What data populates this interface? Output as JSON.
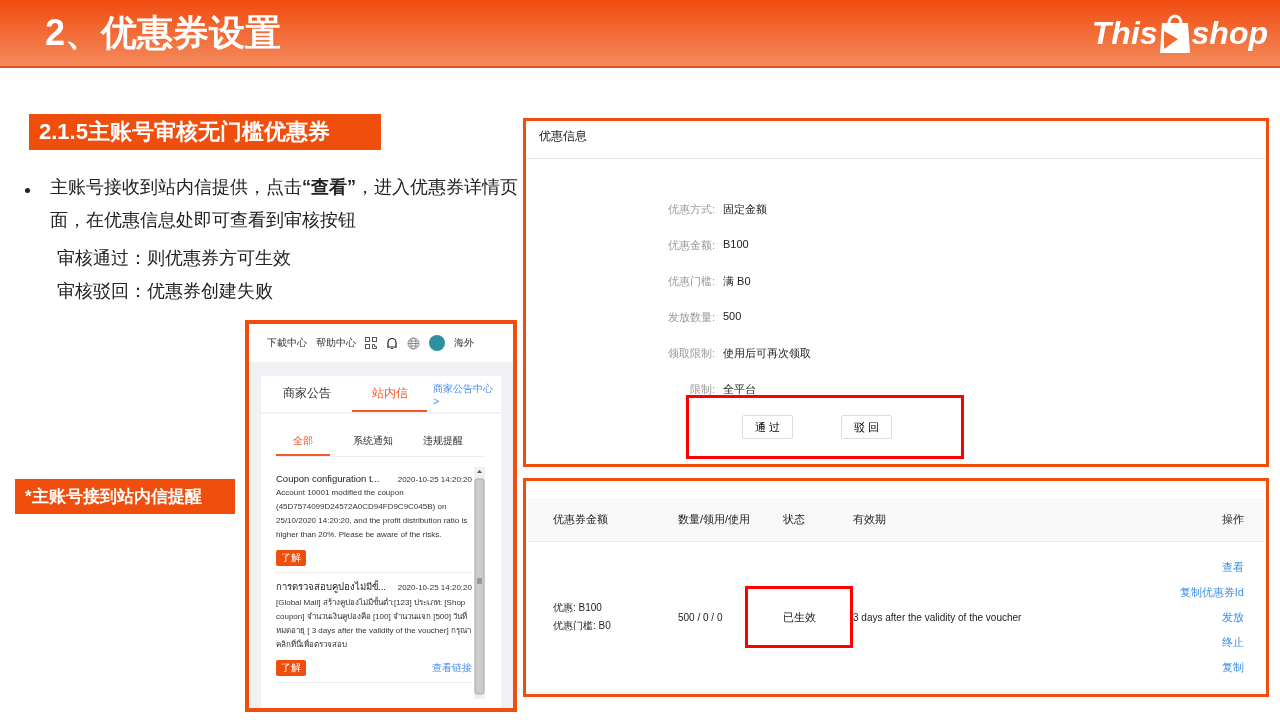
{
  "header": {
    "title": "2、优惠券设置",
    "logo": {
      "left": "This",
      "right": "shop"
    }
  },
  "section_title": "2.1.5主账号审核无门槛优惠券",
  "bullet": "主账号接收到站内信提供，点击**“查看”**，进入优惠券详情页面，在优惠信息处即可查看到审核按钮",
  "notes": [
    "审核通过：则优惠券方可生效",
    "审核驳回：优惠券创建失败"
  ],
  "caption": "*主账号接到站内信提醒",
  "message_panel": {
    "top_links": [
      "下載中心",
      "帮助中心"
    ],
    "region": "海外",
    "tabs": [
      {
        "label": "商家公告",
        "selected": false
      },
      {
        "label": "站内信",
        "selected": true
      }
    ],
    "center_link": "商家公告中心 >",
    "subtabs": [
      {
        "label": "全部",
        "selected": true
      },
      {
        "label": "系统通知",
        "selected": false
      },
      {
        "label": "违规提醒",
        "selected": false
      }
    ],
    "messages": [
      {
        "title": "Coupon configuration t...",
        "time": "2020-10-25 14:20:20",
        "body": "Account 10001 modified the coupon (45D7574099D24572A0CD94FD9C9C045B) on 25/10/2020 14:20:20, and the profit distribution ratio is higher than 20%. Please be aware of the risks.",
        "button": "了解"
      },
      {
        "title": "การตรวจสอบคูปองไม่มีขั้...",
        "time": "2020-10-25 14:20:20",
        "body": "[Global Mall] สร้างคูปองไม่มีขั้นต่ำ:[123] ประเภท: [Shop coupon] จำนวนเงินคูปองคือ [100] จำนวนแจก [500] วันที่หมดอายุ [ 3 days after the validity of the voucher] กรุณาคลิกที่นี่เพื่อตรวจสอบ",
        "button": "了解",
        "link": "查看链接"
      }
    ]
  },
  "info_panel": {
    "title": "优惠信息",
    "fields": [
      {
        "label": "优惠方式:",
        "value": "固定金额"
      },
      {
        "label": "优惠金额:",
        "value": "B100"
      },
      {
        "label": "优惠门槛:",
        "value": "满 B0"
      },
      {
        "label": "发放数量:",
        "value": "500"
      },
      {
        "label": "领取限制:",
        "value": "使用后可再次领取"
      },
      {
        "label": "限制:",
        "value": "全平台"
      }
    ],
    "buttons": [
      "通 过",
      "驳 回"
    ]
  },
  "table": {
    "columns": [
      "优惠券金额",
      "数量/领用/使用",
      "状态",
      "有效期",
      "操作"
    ],
    "rows": [
      {
        "amount": [
          "优惠: B100",
          "优惠门槛: B0"
        ],
        "counts": "500 / 0 / 0",
        "status": "已生效",
        "validity": "3 days after the validity of the voucher",
        "actions": [
          "查看",
          "复制优惠券Id",
          "发放",
          "终止",
          "复制"
        ]
      }
    ]
  }
}
